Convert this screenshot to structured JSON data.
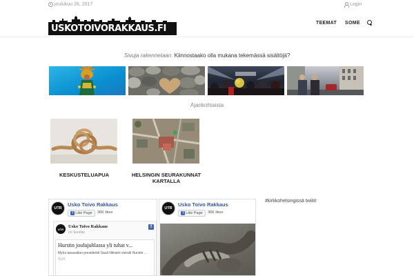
{
  "topbar": {
    "date": "joulukuu 26, 2017",
    "login": "Login",
    "icons": {
      "date": "clock-icon",
      "login": "user-icon"
    }
  },
  "header": {
    "logo_text": "USKOTOIVORAKKAUS.FI",
    "nav": {
      "teemat": "TEEMAT",
      "some": "SOME"
    },
    "search_icon": "search-icon"
  },
  "intro": {
    "pre": "Sivuja rakennetaan.",
    "cta": "Kiinnostaako olla mukana tekemässä sisältöjä?"
  },
  "section_title": "Ajankohtaista",
  "cards": [
    {
      "label": "KESKUSTELUAPUA"
    },
    {
      "label": "HELSINGIN SEURAKUNNAT KARTALLA"
    }
  ],
  "facebook": {
    "page_name": "Usko Toivo Rakkaus",
    "avatar_text": "UTR",
    "like_button": "Like Page",
    "likes": "36K likes",
    "post": {
      "author": "Usko Toivo Rakkaus",
      "meta": "on Sunday",
      "headline": "Hurstin joulujuhlassa yli tuhat v...",
      "description": "Myös tasavallan presidentti Sauli Niinistö vieraili Hurstin ...",
      "source": "IS.FI"
    }
  },
  "twitter": {
    "title": "#kirkkohelsingissä twiitit"
  },
  "colors": {
    "fb_blue": "#365899",
    "fb_button": "#4267b2",
    "logo_bg": "#111111"
  }
}
